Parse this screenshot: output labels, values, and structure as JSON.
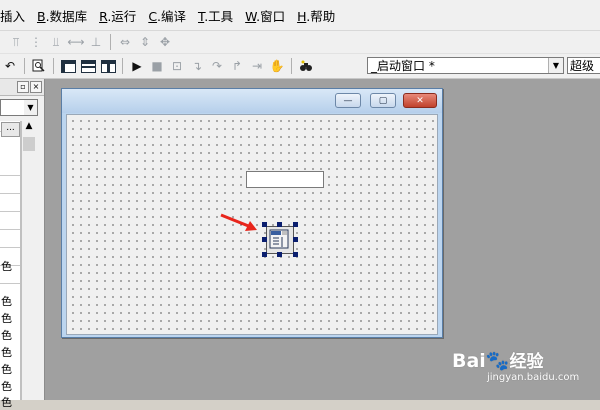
{
  "menu": [
    {
      "mnemonic": "",
      "label": "插入"
    },
    {
      "mnemonic": "B",
      "label": ".数据库"
    },
    {
      "mnemonic": "R",
      "label": ".运行"
    },
    {
      "mnemonic": "C",
      "label": ".编译"
    },
    {
      "mnemonic": "T",
      "label": ".工具"
    },
    {
      "mnemonic": "W",
      "label": ".窗口"
    },
    {
      "mnemonic": "H",
      "label": ".帮助"
    }
  ],
  "toolbar": {
    "window_combo_value": "_启动窗口 *",
    "component_combo_value": "超级"
  },
  "left_panel": {
    "dots_label": "...",
    "cells": [
      "色",
      "色",
      "色",
      "色",
      "色",
      "色",
      "色",
      "色"
    ]
  },
  "form_window": {
    "minimize_glyph": "—",
    "maximize_glyph": "▢",
    "close_glyph": "✕"
  },
  "watermark": {
    "logo": "Bai",
    "brand": "经验",
    "url": "jingyan.baidu.com"
  },
  "colors": {
    "arrow": "#e8251c",
    "selection_handle": "#0a1e6e"
  }
}
